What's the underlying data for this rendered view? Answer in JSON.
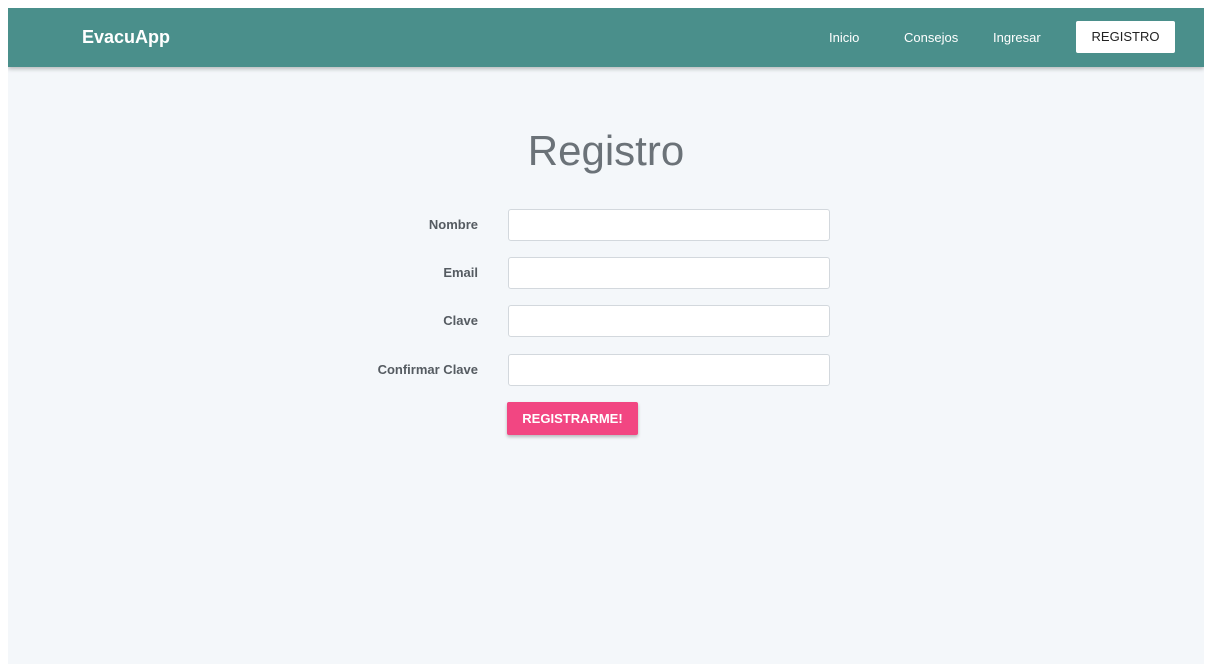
{
  "navbar": {
    "brand": "EvacuApp",
    "links": [
      {
        "label": "Inicio"
      },
      {
        "label": "Consejos"
      },
      {
        "label": "Ingresar"
      }
    ],
    "active_button": "REGISTRO"
  },
  "form": {
    "title": "Registro",
    "fields": [
      {
        "label": "Nombre",
        "value": "",
        "placeholder": ""
      },
      {
        "label": "Email",
        "value": "",
        "placeholder": ""
      },
      {
        "label": "Clave",
        "value": "",
        "placeholder": ""
      },
      {
        "label": "Confirmar Clave",
        "value": "",
        "placeholder": ""
      }
    ],
    "submit_label": "REGISTRARME!"
  },
  "colors": {
    "navbar": "#4a8f8b",
    "background": "#f4f7fa",
    "accent": "#f24682",
    "title": "#6b7278"
  }
}
